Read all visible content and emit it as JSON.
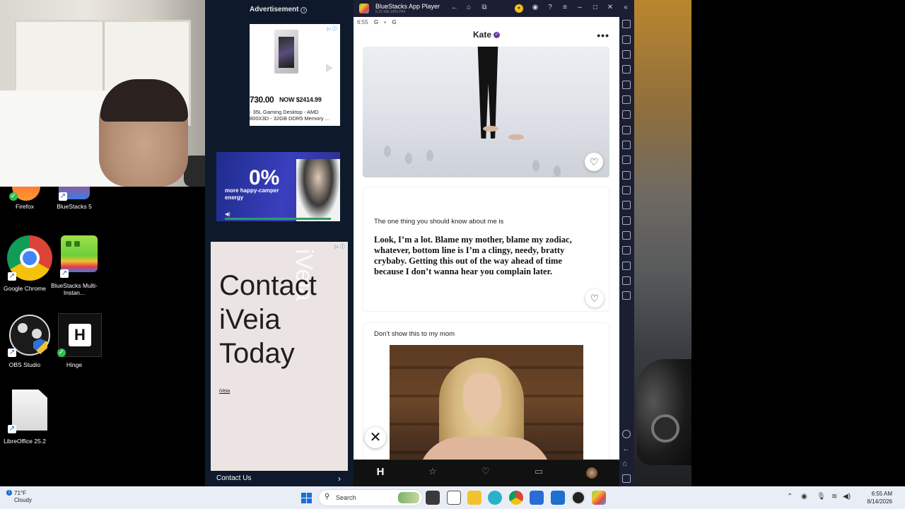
{
  "desktop": {
    "icons": [
      {
        "label": "Firefox"
      },
      {
        "label": "BlueStacks 5"
      },
      {
        "label": "Google Chrome"
      },
      {
        "label": "BlueStacks Multi-Instan..."
      },
      {
        "label": "OBS Studio"
      },
      {
        "label": "Hinge"
      },
      {
        "label": "LibreOffice 25.2"
      }
    ]
  },
  "ads": {
    "header": "Advertisement",
    "pc_card": {
      "price": "730.00",
      "now_price": "NOW $2414.99",
      "description": "- 35L Gaming Desktop - AMD 800X3D - 32GB DDR5 Memory ..."
    },
    "promo_card": {
      "percent": "0%",
      "tagline_1": "more happy-camper",
      "tagline_2": "energy"
    },
    "iveia_card": {
      "line1": "Contact",
      "line2": "iVeia",
      "line3": "Today",
      "watermark": "iVeia",
      "small_link": "iVeia"
    },
    "contact_label": "Contact Us"
  },
  "bluestacks": {
    "title": "BlueStacks App Player",
    "version": "5.22.166.1003 P64"
  },
  "hinge": {
    "status_time": "6:55",
    "status_icons": [
      "G",
      "▪",
      "G"
    ],
    "profile_name": "Kate",
    "prompt1": {
      "question": "The one thing you should know about me is",
      "answer": "Look, I’m a lot. Blame my mother, blame my zodiac, whatever, bottom line is I’m a clingy, needy, bratty crybaby. Getting this out of the way ahead of time because I don’t wanna hear you complain later."
    },
    "prompt2": {
      "question": "Don’t show this to my mom"
    },
    "nav": [
      "discover",
      "standouts",
      "likes-you",
      "matches",
      "profile"
    ]
  },
  "taskbar": {
    "weather_temp": "71°F",
    "weather_desc": "Cloudy",
    "search_placeholder": "Search",
    "time": "6:55 AM",
    "date": "8/14/2026"
  }
}
